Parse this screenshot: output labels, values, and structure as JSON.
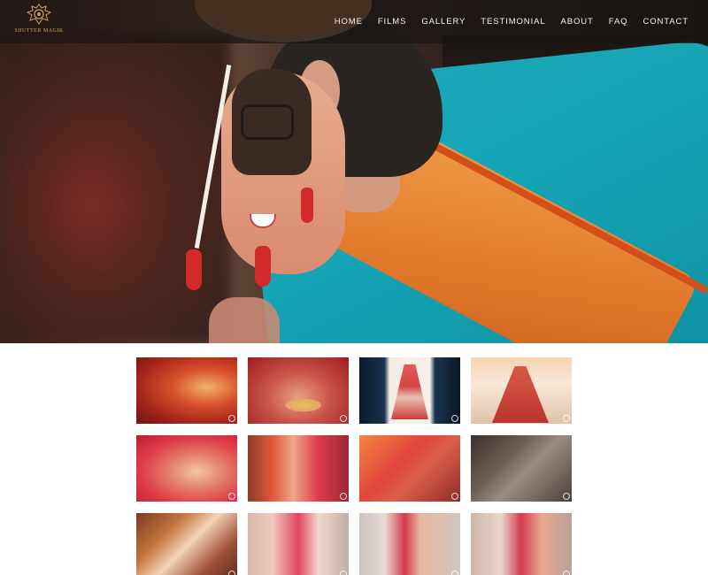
{
  "brand": {
    "name": "SHUTTER MAGIK",
    "accent": "#c9a45a"
  },
  "nav": {
    "items": [
      {
        "label": "HOME"
      },
      {
        "label": "FILMS"
      },
      {
        "label": "GALLERY"
      },
      {
        "label": "TESTIMONIAL"
      },
      {
        "label": "ABOUT"
      },
      {
        "label": "FAQ"
      },
      {
        "label": "CONTACT"
      }
    ]
  },
  "gallery": {
    "thumbnail_count": 12,
    "thumb_icon": "zoom-icon"
  }
}
